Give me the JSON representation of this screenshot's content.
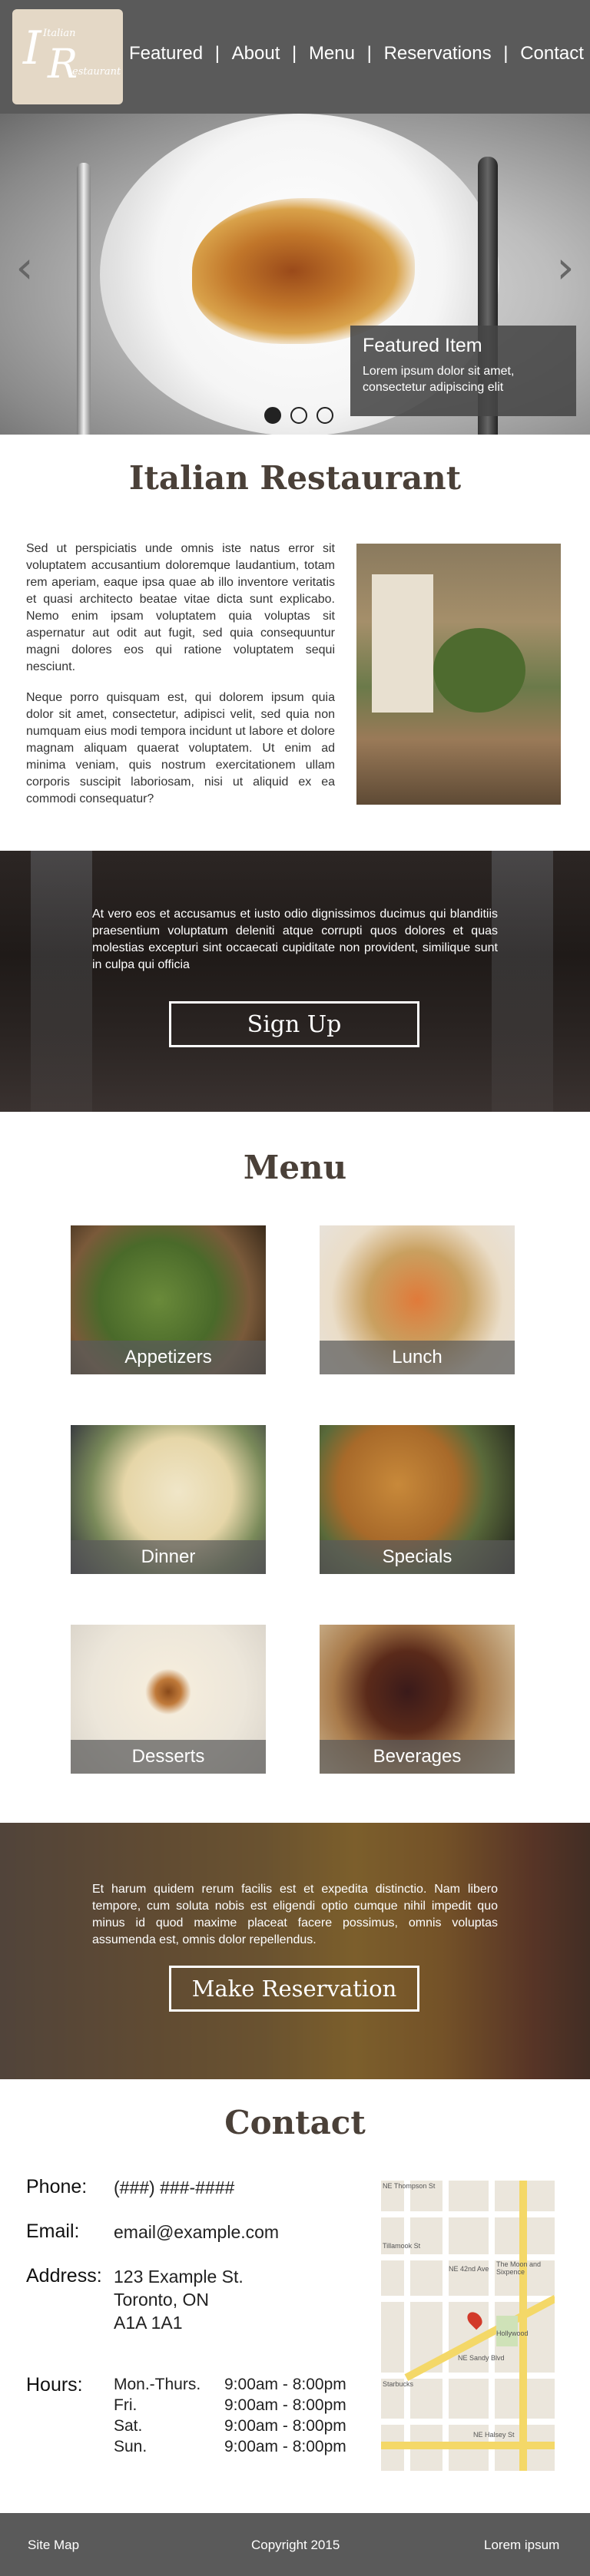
{
  "logo": {
    "line1": "Italian",
    "letter_i": "I",
    "letter_r": "R",
    "line2": "estaurant"
  },
  "nav": {
    "items": [
      "Featured",
      "About",
      "Menu",
      "Reservations",
      "Contact"
    ],
    "separator": "|"
  },
  "hero": {
    "prev_icon": "chevron-left-icon",
    "next_icon": "chevron-right-icon",
    "prev_glyph": "‹",
    "next_glyph": "›",
    "featured_title": "Featured Item",
    "featured_text": "Lorem ipsum dolor sit amet, consectetur adipiscing elit",
    "slides": 3,
    "active_slide": 1
  },
  "about": {
    "title": "Italian Restaurant",
    "paragraph1": "Sed ut perspiciatis unde omnis iste natus error sit voluptatem accusantium doloremque laudantium, totam rem aperiam, eaque ipsa quae ab illo inventore veritatis et quasi architecto beatae vitae dicta sunt explicabo. Nemo enim ipsam voluptatem quia voluptas sit aspernatur aut odit aut fugit, sed quia consequuntur magni dolores eos qui ratione voluptatem sequi nesciunt.",
    "paragraph2": "Neque porro quisquam est, qui dolorem ipsum quia dolor sit amet, consectetur, adipisci velit, sed quia non numquam eius modi tempora incidunt ut labore et dolore magnam aliquam quaerat voluptatem. Ut enim ad minima veniam, quis nostrum exercitationem ullam corporis suscipit laboriosam, nisi ut aliquid ex ea commodi consequatur?"
  },
  "signup": {
    "text": "At vero eos et accusamus et iusto odio dignissimos ducimus qui blanditiis praesentium voluptatum deleniti atque corrupti quos dolores et quas molestias excepturi sint occaecati cupiditate non provident, similique sunt in culpa qui officia",
    "button": "Sign Up"
  },
  "menu": {
    "title": "Menu",
    "items": [
      "Appetizers",
      "Lunch",
      "Dinner",
      "Specials",
      "Desserts",
      "Beverages"
    ]
  },
  "reservation": {
    "text": "Et harum quidem rerum facilis est et expedita distinctio. Nam libero tempore, cum soluta nobis est eligendi optio cumque nihil impedit quo minus id quod maxime placeat facere possimus, omnis voluptas assumenda est, omnis dolor repellendus.",
    "button": "Make Reservation"
  },
  "contact": {
    "title": "Contact",
    "phone_label": "Phone:",
    "phone": "(###) ###-####",
    "email_label": "Email:",
    "email": "email@example.com",
    "address_label": "Address:",
    "address_line1": "123 Example St.",
    "address_line2": "Toronto, ON",
    "address_line3": "A1A 1A1",
    "hours_label": "Hours:",
    "hours": [
      {
        "day": "Mon.-Thurs.",
        "time": "9:00am - 8:00pm"
      },
      {
        "day": "Fri.",
        "time": "9:00am - 8:00pm"
      },
      {
        "day": "Sat.",
        "time": "9:00am - 8:00pm"
      },
      {
        "day": "Sun.",
        "time": "9:00am - 8:00pm"
      }
    ],
    "map_labels": [
      "NE Thompson St",
      "Tillamook St",
      "NE 42nd Ave",
      "NE Sandy Blvd",
      "NE Halsey St",
      "Hollywood",
      "The Moon and Sixpence",
      "Starbucks"
    ]
  },
  "footer": {
    "left": "Site Map",
    "center": "Copyright 2015",
    "right": "Lorem ipsum"
  },
  "colors": {
    "header_bg": "#5a5a5a",
    "title_brown": "#4a4038",
    "footer_bg": "#5a5a5a"
  }
}
